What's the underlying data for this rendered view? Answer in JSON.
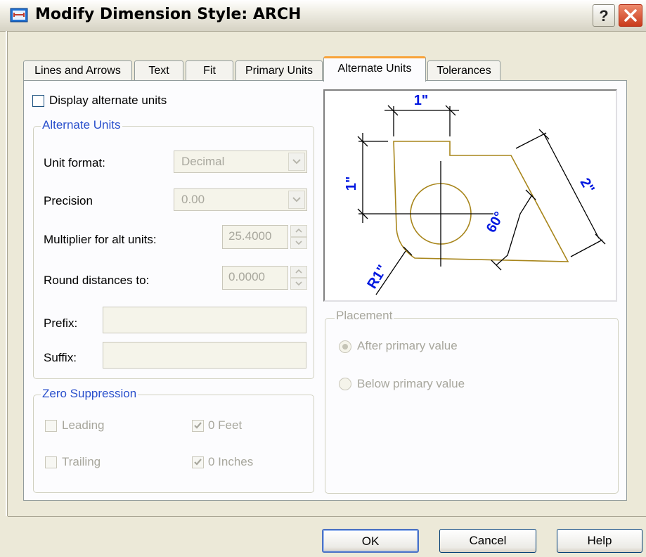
{
  "window": {
    "title": "Modify Dimension Style: ARCH",
    "help_glyph": "?",
    "icon": "dimension-style-icon"
  },
  "tabs": [
    {
      "label": "Lines and Arrows",
      "active": false
    },
    {
      "label": "Text",
      "active": false
    },
    {
      "label": "Fit",
      "active": false
    },
    {
      "label": "Primary Units",
      "active": false
    },
    {
      "label": "Alternate Units",
      "active": true
    },
    {
      "label": "Tolerances",
      "active": false
    }
  ],
  "display_alt": {
    "label": "Display alternate units",
    "checked": false
  },
  "alternate_units": {
    "title": "Alternate Units",
    "unit_format": {
      "label": "Unit format:",
      "value": "Decimal"
    },
    "precision": {
      "label": "Precision",
      "value": "0.00"
    },
    "multiplier": {
      "label": "Multiplier for alt units:",
      "value": "25.4000"
    },
    "round": {
      "label": "Round distances  to:",
      "value": "0.0000"
    },
    "prefix": {
      "label": "Prefix:",
      "value": ""
    },
    "suffix": {
      "label": "Suffix:",
      "value": ""
    }
  },
  "zero_suppression": {
    "title": "Zero Suppression",
    "leading": {
      "label": "Leading",
      "checked": false
    },
    "trailing": {
      "label": "Trailing",
      "checked": false
    },
    "feet": {
      "label": "0 Feet",
      "checked": true
    },
    "inches": {
      "label": "0 Inches",
      "checked": true
    }
  },
  "preview": {
    "dim_top": "1\"",
    "dim_left": "1\"",
    "dim_right": "2\"",
    "dim_angle": "60°",
    "dim_radius": "R1\"",
    "colors": {
      "geometry": "#a8861c",
      "dims": "#000000",
      "text": "#0018e0"
    }
  },
  "placement": {
    "title": "Placement",
    "after": {
      "label": "After primary value",
      "selected": true
    },
    "below": {
      "label": "Below primary value",
      "selected": false
    }
  },
  "buttons": {
    "ok": "OK",
    "cancel": "Cancel",
    "help": "Help"
  }
}
